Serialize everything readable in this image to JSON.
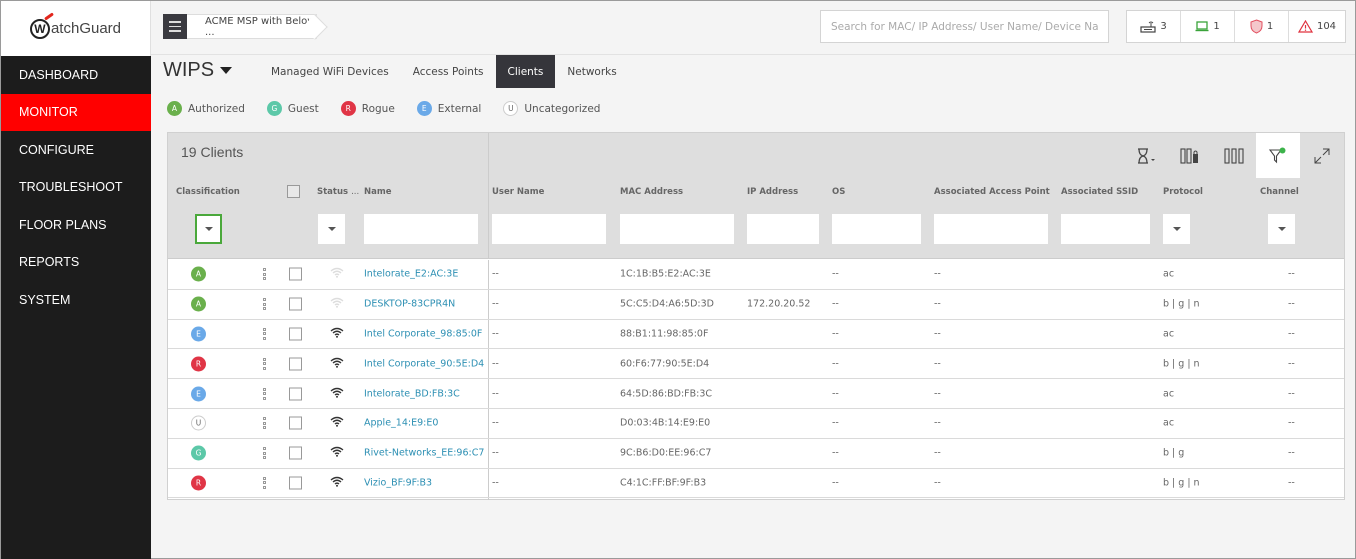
{
  "brand": {
    "name": "atchGuard",
    "mark": "W"
  },
  "sidebar": {
    "items": [
      {
        "label": "DASHBOARD",
        "active": false
      },
      {
        "label": "MONITOR",
        "active": true
      },
      {
        "label": "CONFIGURE",
        "active": false
      },
      {
        "label": "TROUBLESHOOT",
        "active": false
      },
      {
        "label": "FLOOR PLANS",
        "active": false
      },
      {
        "label": "REPORTS",
        "active": false
      },
      {
        "label": "SYSTEM",
        "active": false
      }
    ]
  },
  "topbar": {
    "breadcrumb": "ACME MSP with Below ...",
    "search_placeholder": "Search for MAC/ IP Address/ User Name/ Device Name.",
    "stats": [
      {
        "icon": "access-point-icon",
        "value": "3"
      },
      {
        "icon": "laptop-icon",
        "value": "1"
      },
      {
        "icon": "shield-icon",
        "value": "1"
      },
      {
        "icon": "warning-icon",
        "value": "104"
      }
    ]
  },
  "page": {
    "title": "WIPS",
    "tabs": [
      {
        "label": "Managed WiFi Devices",
        "active": false
      },
      {
        "label": "Access Points",
        "active": false
      },
      {
        "label": "Clients",
        "active": true
      },
      {
        "label": "Networks",
        "active": false
      }
    ]
  },
  "legend": [
    {
      "code": "A",
      "label": "Authorized",
      "color": "#6ab04c"
    },
    {
      "code": "G",
      "label": "Guest",
      "color": "#5cc8a8"
    },
    {
      "code": "R",
      "label": "Rogue",
      "color": "#e03546"
    },
    {
      "code": "E",
      "label": "External",
      "color": "#6aa9e8"
    },
    {
      "code": "U",
      "label": "Uncategorized",
      "color": "#ffffff"
    }
  ],
  "table": {
    "count_label": "19 Clients",
    "columns": {
      "classification": "Classification",
      "status": "Status",
      "status_more": "...",
      "name": "Name",
      "user_name": "User Name",
      "mac": "MAC Address",
      "ip": "IP Address",
      "os": "OS",
      "ap": "Associated Access Point",
      "ssid": "Associated SSID",
      "protocol": "Protocol",
      "channel": "Channel"
    },
    "rows": [
      {
        "cls": "A",
        "online": false,
        "name": "Intelorate_E2:AC:3E",
        "user": "--",
        "mac": "1C:1B:B5:E2:AC:3E",
        "ip": "",
        "os": "--",
        "ap": "--",
        "ssid": "",
        "protocol": "ac",
        "channel": "--"
      },
      {
        "cls": "A",
        "online": false,
        "name": "DESKTOP-83CPR4N",
        "user": "--",
        "mac": "5C:C5:D4:A6:5D:3D",
        "ip": "172.20.20.52",
        "os": "--",
        "ap": "--",
        "ssid": "",
        "protocol": "b | g | n",
        "channel": "--"
      },
      {
        "cls": "E",
        "online": true,
        "name": "Intel Corporate_98:85:0F",
        "user": "--",
        "mac": "88:B1:11:98:85:0F",
        "ip": "",
        "os": "--",
        "ap": "--",
        "ssid": "",
        "protocol": "ac",
        "channel": "--"
      },
      {
        "cls": "R",
        "online": true,
        "name": "Intel Corporate_90:5E:D4",
        "user": "--",
        "mac": "60:F6:77:90:5E:D4",
        "ip": "",
        "os": "--",
        "ap": "--",
        "ssid": "",
        "protocol": "b | g | n",
        "channel": "--"
      },
      {
        "cls": "E",
        "online": true,
        "name": "Intelorate_BD:FB:3C",
        "user": "--",
        "mac": "64:5D:86:BD:FB:3C",
        "ip": "",
        "os": "--",
        "ap": "--",
        "ssid": "",
        "protocol": "ac",
        "channel": "--"
      },
      {
        "cls": "U",
        "online": true,
        "name": "Apple_14:E9:E0",
        "user": "--",
        "mac": "D0:03:4B:14:E9:E0",
        "ip": "",
        "os": "--",
        "ap": "--",
        "ssid": "",
        "protocol": "ac",
        "channel": "--"
      },
      {
        "cls": "G",
        "online": true,
        "name": "Rivet-Networks_EE:96:C7",
        "user": "--",
        "mac": "9C:B6:D0:EE:96:C7",
        "ip": "",
        "os": "--",
        "ap": "--",
        "ssid": "",
        "protocol": "b | g",
        "channel": "--"
      },
      {
        "cls": "R",
        "online": true,
        "name": "Vizio_BF:9F:B3",
        "user": "--",
        "mac": "C4:1C:FF:BF:9F:B3",
        "ip": "",
        "os": "--",
        "ap": "--",
        "ssid": "",
        "protocol": "b | g | n",
        "channel": "--"
      }
    ]
  },
  "colors": {
    "accent": "#ff0000",
    "link": "#2c8fb3",
    "filter_active": "#4aa83b"
  }
}
